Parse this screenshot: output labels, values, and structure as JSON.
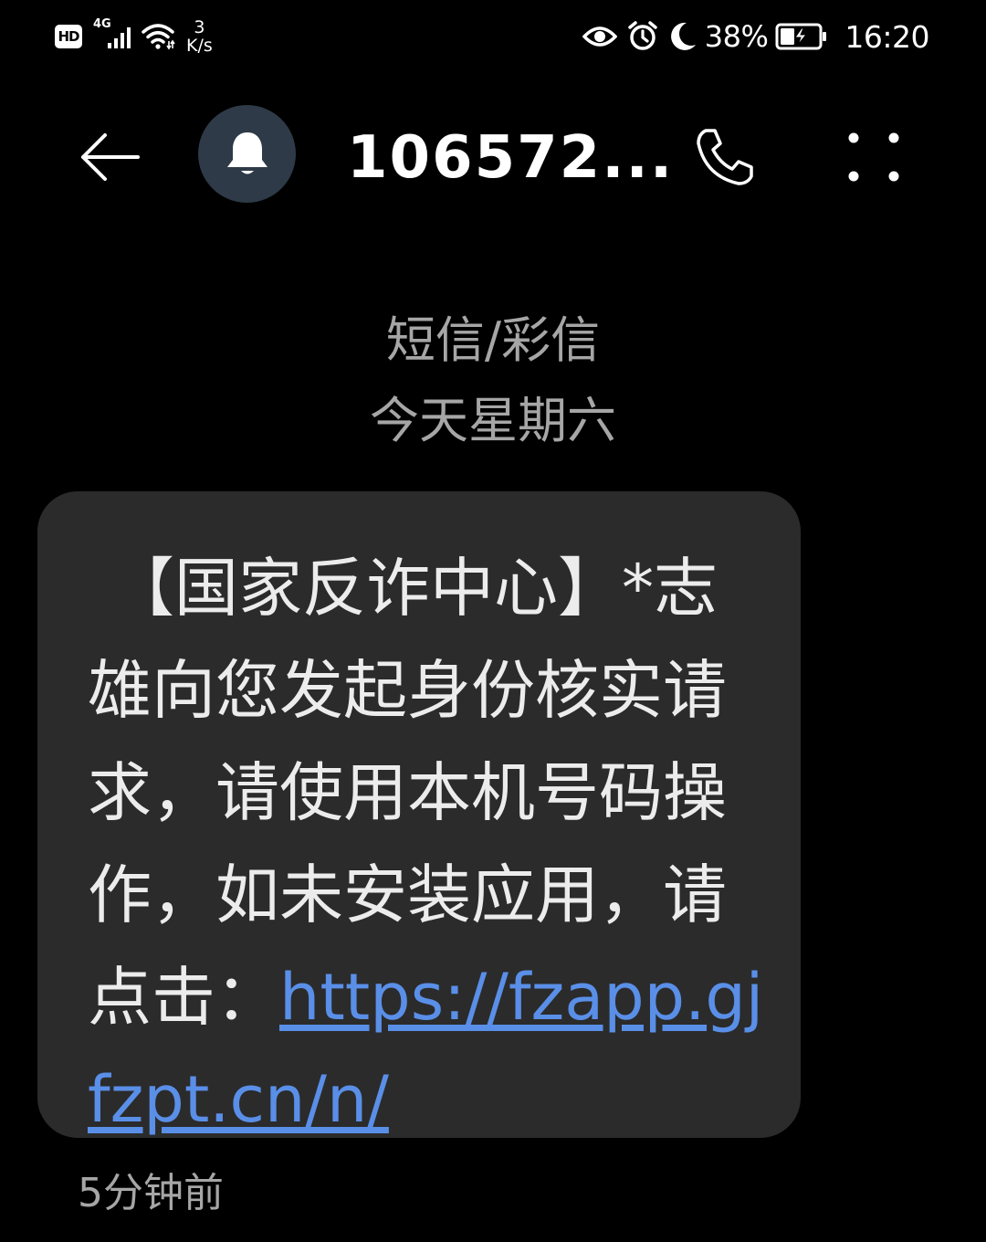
{
  "status_bar": {
    "hd_label": "HD",
    "network_type": "4G",
    "speed_value": "3",
    "speed_unit": "K/s",
    "battery_percent": "38%",
    "time": "16:20",
    "icons": [
      "signal-icon",
      "wifi-icon",
      "eye-icon",
      "alarm-icon",
      "moon-icon",
      "battery-charging-icon"
    ]
  },
  "header": {
    "contact_name": "106572...",
    "avatar_icon": "bell-icon",
    "back_icon": "back-arrow-icon",
    "call_icon": "phone-icon",
    "more_icon": "more-dots-icon"
  },
  "conversation": {
    "message_type": "短信/彩信",
    "date_label": "今天星期六"
  },
  "message": {
    "body_text": "【国家反诈中心】*志雄向您发起身份核实请求，请使用本机号码操作，如未安装应用，请点击：",
    "link_text": "https://fzapp.gjfzpt.cn/n/",
    "time_ago": "5分钟前"
  },
  "colors": {
    "background": "#000000",
    "bubble": "#2b2b2b",
    "link": "#5a8fe8",
    "avatar": "#2e3a47",
    "secondary_text": "#a6a6a6"
  }
}
